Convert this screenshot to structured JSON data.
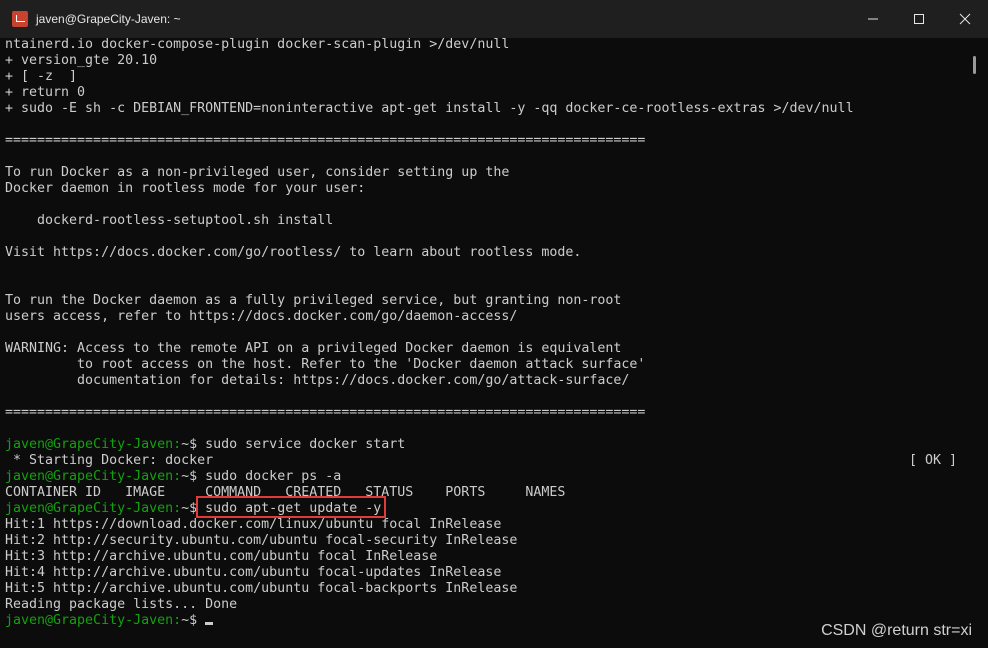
{
  "window": {
    "title": "javen@GrapeCity-Javen: ~",
    "controls": [
      "minimize-icon",
      "maximize-icon",
      "close-icon"
    ]
  },
  "terminal": {
    "lines": [
      {
        "type": "text",
        "text": "ntainerd.io docker-compose-plugin docker-scan-plugin >/dev/null"
      },
      {
        "type": "text",
        "text": "+ version_gte 20.10"
      },
      {
        "type": "text",
        "text": "+ [ -z  ]"
      },
      {
        "type": "text",
        "text": "+ return 0"
      },
      {
        "type": "text",
        "text": "+ sudo -E sh -c DEBIAN_FRONTEND=noninteractive apt-get install -y -qq docker-ce-rootless-extras >/dev/null"
      },
      {
        "type": "text",
        "text": ""
      },
      {
        "type": "text",
        "text": "================================================================================"
      },
      {
        "type": "text",
        "text": ""
      },
      {
        "type": "text",
        "text": "To run Docker as a non-privileged user, consider setting up the"
      },
      {
        "type": "text",
        "text": "Docker daemon in rootless mode for your user:"
      },
      {
        "type": "text",
        "text": ""
      },
      {
        "type": "text",
        "text": "    dockerd-rootless-setuptool.sh install"
      },
      {
        "type": "text",
        "text": ""
      },
      {
        "type": "text",
        "text": "Visit https://docs.docker.com/go/rootless/ to learn about rootless mode."
      },
      {
        "type": "text",
        "text": ""
      },
      {
        "type": "text",
        "text": ""
      },
      {
        "type": "text",
        "text": "To run the Docker daemon as a fully privileged service, but granting non-root"
      },
      {
        "type": "text",
        "text": "users access, refer to https://docs.docker.com/go/daemon-access/"
      },
      {
        "type": "text",
        "text": ""
      },
      {
        "type": "text",
        "text": "WARNING: Access to the remote API on a privileged Docker daemon is equivalent"
      },
      {
        "type": "text",
        "text": "         to root access on the host. Refer to the 'Docker daemon attack surface'"
      },
      {
        "type": "text",
        "text": "         documentation for details: https://docs.docker.com/go/attack-surface/"
      },
      {
        "type": "text",
        "text": ""
      },
      {
        "type": "text",
        "text": "================================================================================"
      },
      {
        "type": "text",
        "text": ""
      },
      {
        "type": "cmd",
        "prompt": "javen@GrapeCity-Javen:",
        "rest": "~$ sudo service docker start"
      },
      {
        "type": "ok",
        "text": " * Starting Docker: docker",
        "right": "[ OK ]"
      },
      {
        "type": "cmd",
        "prompt": "javen@GrapeCity-Javen:",
        "rest": "~$ sudo docker ps -a"
      },
      {
        "type": "text",
        "text": "CONTAINER ID   IMAGE     COMMAND   CREATED   STATUS    PORTS     NAMES"
      },
      {
        "type": "cmd",
        "prompt": "javen@GrapeCity-Javen:",
        "rest": "~$ sudo apt-get update -y"
      },
      {
        "type": "text",
        "text": "Hit:1 https://download.docker.com/linux/ubuntu focal InRelease"
      },
      {
        "type": "text",
        "text": "Hit:2 http://security.ubuntu.com/ubuntu focal-security InRelease"
      },
      {
        "type": "text",
        "text": "Hit:3 http://archive.ubuntu.com/ubuntu focal InRelease"
      },
      {
        "type": "text",
        "text": "Hit:4 http://archive.ubuntu.com/ubuntu focal-updates InRelease"
      },
      {
        "type": "text",
        "text": "Hit:5 http://archive.ubuntu.com/ubuntu focal-backports InRelease"
      },
      {
        "type": "text",
        "text": "Reading package lists... Done"
      },
      {
        "type": "cursor",
        "prompt": "javen@GrapeCity-Javen:",
        "rest": "~$ "
      }
    ]
  },
  "watermark": "CSDN @return str=xi",
  "colors": {
    "background": "#0c0c0c",
    "text": "#cccccc",
    "prompt": "#13a10e",
    "highlight_border": "#e03a3a"
  }
}
